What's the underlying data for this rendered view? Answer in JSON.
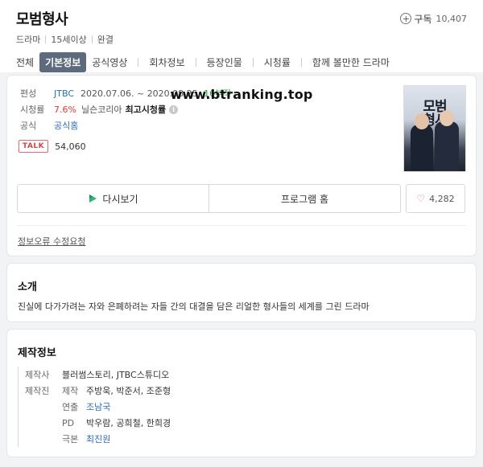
{
  "header": {
    "title": "모범형사",
    "subscribe_label": "구독",
    "subscribe_count": "10,407",
    "meta": [
      "드라마",
      "15세이상",
      "완결"
    ]
  },
  "tabs": [
    "전체",
    "기본정보",
    "공식영상",
    "회차정보",
    "등장인물",
    "시청률",
    "함께 볼만한 드라마"
  ],
  "basic": {
    "broadcast_label": "편성",
    "channel": "JTBC",
    "dates": "2020.07.06. ~ 2020.08.25.",
    "episodes": "16부작",
    "rating_label": "시청률",
    "rating_value": "7.6%",
    "rating_source": "닐슨코리아",
    "rating_note": "최고시청률",
    "official_label": "공식",
    "official_link": "공식홈",
    "talk_badge": "TALK",
    "talk_count": "54,060",
    "poster_title": "모범\n형사"
  },
  "watermark": "www.btranking.top",
  "actions": {
    "replay": "다시보기",
    "program_home": "프로그램 홈",
    "like_count": "4,282",
    "report": "정보오류 수정요청"
  },
  "intro": {
    "title": "소개",
    "text": "진실에 다가가려는 자와 은폐하려는 자들 간의 대결을 담은 리얼한 형사들의 세계를 그린 드라마"
  },
  "production": {
    "title": "제작정보",
    "company_label": "제작사",
    "company": "블러썸스토리, JTBC스튜디오",
    "staff_label": "제작진",
    "producer_label": "제작",
    "producers": "주방욱, 박준서, 조준형",
    "director_label": "연출",
    "director": "조남국",
    "pd_label": "PD",
    "pds": "박우람, 공희철, 한희경",
    "writer_label": "극본",
    "writer": "최진원"
  }
}
